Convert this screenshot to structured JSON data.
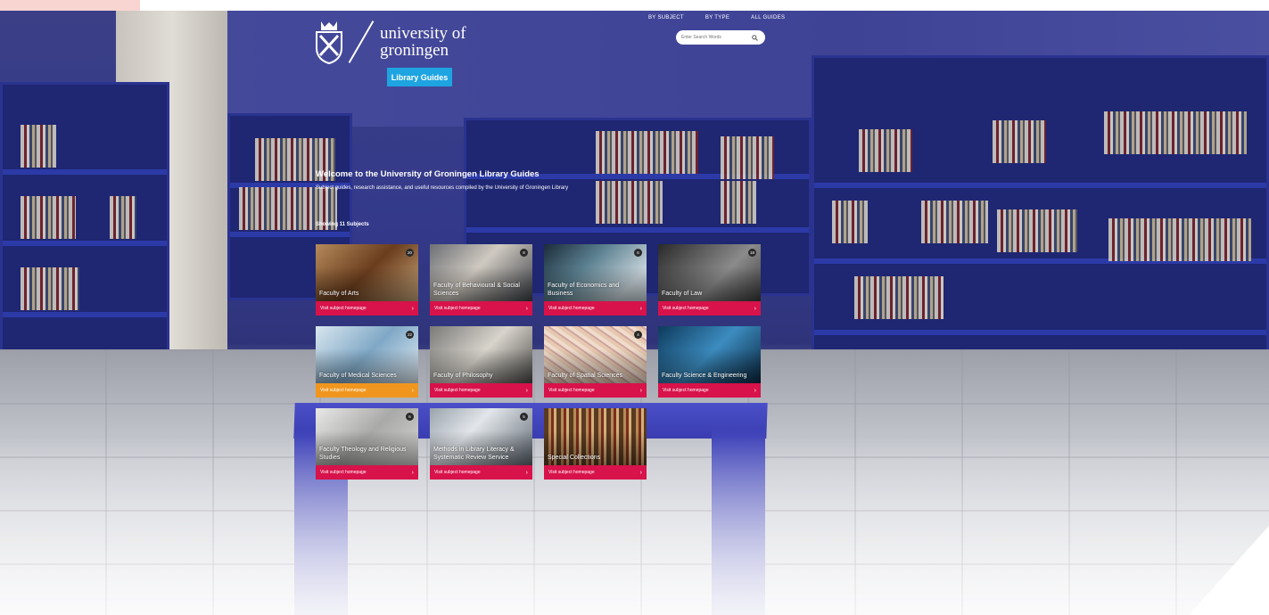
{
  "header": {
    "university_line1": "university of",
    "university_line2": "groningen",
    "library_button": "Library Guides",
    "nav": [
      "BY SUBJECT",
      "BY TYPE",
      "ALL GUIDES"
    ],
    "search_placeholder": "Enter Search Words"
  },
  "intro": {
    "welcome": "Welcome to the University of Groningen Library Guides",
    "subtitle": "Subject guides, research assistance, and useful resources compiled by the University of Groningen Library",
    "showing": "Showing 11 Subjects"
  },
  "footer_label": "Visit subject homepage",
  "cards": [
    {
      "title": "Faculty of Arts",
      "badge": "20",
      "theme": "arts",
      "footer_color": "#d8124a"
    },
    {
      "title": "Faculty of Behavioural & Social Sciences",
      "badge": "8",
      "theme": "behav",
      "footer_color": "#d8124a"
    },
    {
      "title": "Faculty of Economics and Business",
      "badge": "6",
      "theme": "econ",
      "footer_color": "#d8124a"
    },
    {
      "title": "Faculty of Law",
      "badge": "18",
      "theme": "law",
      "footer_color": "#d8124a"
    },
    {
      "title": "Faculty of Medical Sciences",
      "badge": "22",
      "theme": "med",
      "footer_color": "#f0961e"
    },
    {
      "title": "Faculty of Philosophy",
      "badge": "",
      "theme": "phil",
      "footer_color": "#d8124a"
    },
    {
      "title": "Faculty of Spatial Sciences",
      "badge": "4",
      "theme": "spatial",
      "footer_color": "#d8124a"
    },
    {
      "title": "Faculty Science & Engineering",
      "badge": "",
      "theme": "science",
      "footer_color": "#d8124a"
    },
    {
      "title": "Faculty Theology and Religious Studies",
      "badge": "6",
      "theme": "theo",
      "footer_color": "#d8124a"
    },
    {
      "title": "Methods in Library Literacy & Systematic Review Service",
      "badge": "5",
      "theme": "method",
      "footer_color": "#d8124a"
    },
    {
      "title": "Special Collections",
      "badge": "",
      "theme": "special",
      "footer_color": "#d8124a"
    }
  ]
}
